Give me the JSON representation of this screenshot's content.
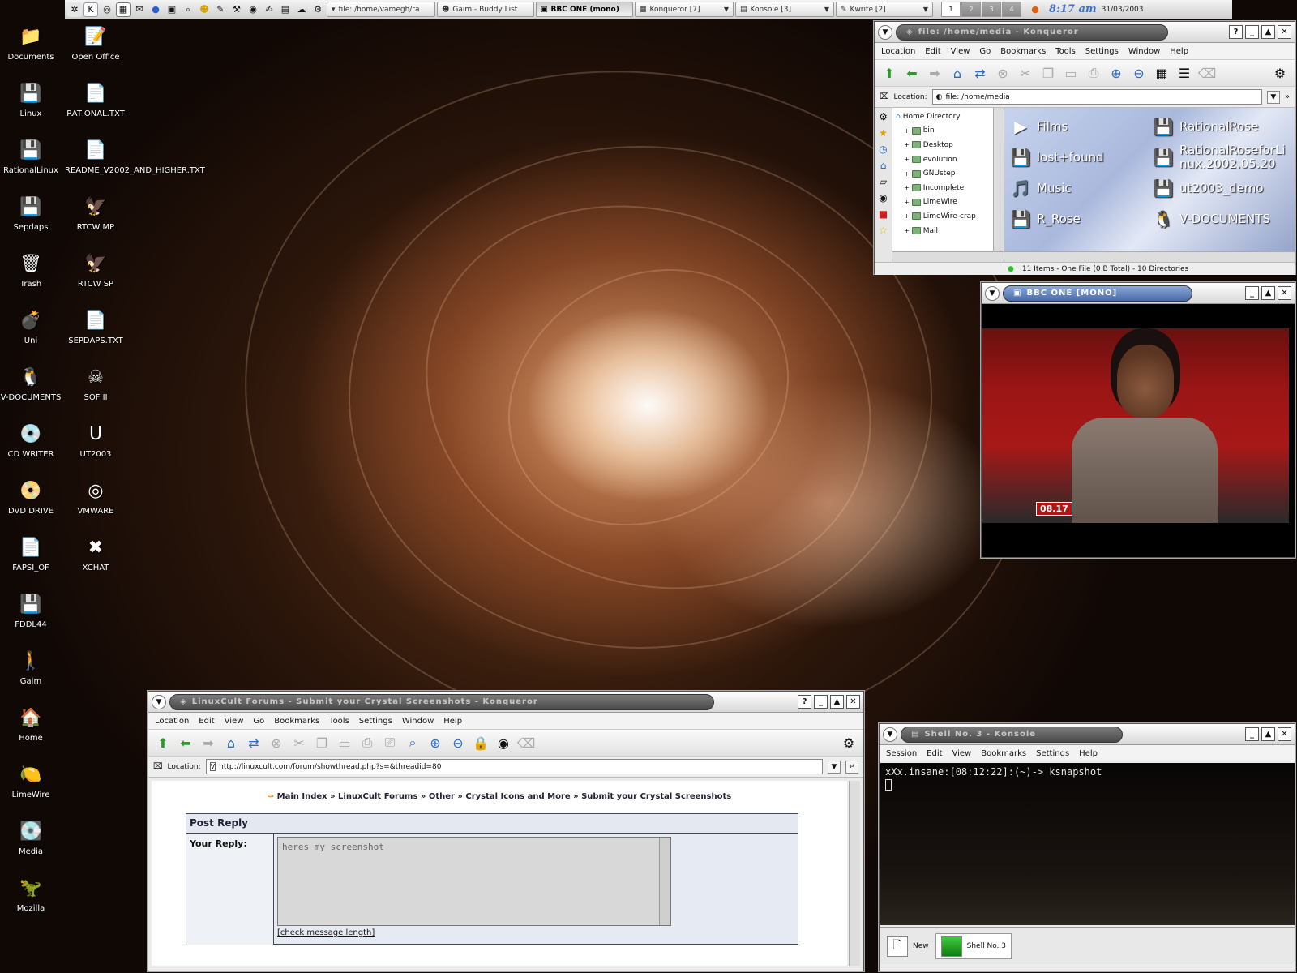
{
  "taskbar": {
    "tasks": [
      {
        "label": "file: /home/vamegh/ra",
        "active": false
      },
      {
        "label": "Gaim - Buddy List",
        "active": false
      },
      {
        "label": "BBC ONE (mono)",
        "active": true
      },
      {
        "label": "Konqueror [7]",
        "active": false
      },
      {
        "label": "Konsole [3]",
        "active": false
      },
      {
        "label": "Kwrite [2]",
        "active": false
      }
    ],
    "pager": [
      "1",
      "2",
      "3",
      "4"
    ],
    "clock": "8:17 am",
    "date": "31/03/2003"
  },
  "desktop": {
    "icons_left": [
      {
        "label": "Documents",
        "glyph": "📁"
      },
      {
        "label": "Linux",
        "glyph": "💾"
      },
      {
        "label": "RationalLinux",
        "glyph": "💾"
      },
      {
        "label": "Sepdaps",
        "glyph": "💾"
      },
      {
        "label": "Trash",
        "glyph": "🗑"
      },
      {
        "label": "Uni",
        "glyph": "💣"
      },
      {
        "label": "V-DOCUMENTS",
        "glyph": "🐧"
      },
      {
        "label": "CD WRITER",
        "glyph": "💿"
      },
      {
        "label": "DVD DRIVE",
        "glyph": "📀"
      },
      {
        "label": "FAPSI_OF",
        "glyph": "📄"
      },
      {
        "label": "FDDL44",
        "glyph": "💾"
      },
      {
        "label": "Gaim",
        "glyph": "🚶"
      },
      {
        "label": "Home",
        "glyph": "🏠"
      },
      {
        "label": "LimeWire",
        "glyph": "🍋"
      },
      {
        "label": "Media",
        "glyph": "💽"
      },
      {
        "label": "Mozilla",
        "glyph": "🦖"
      }
    ],
    "icons_right": [
      {
        "label": "Open Office",
        "glyph": "📝"
      },
      {
        "label": "RATIONAL.TXT",
        "glyph": "📄"
      },
      {
        "label": "README_V2002_AND_HIGHER.TXT",
        "glyph": "📄"
      },
      {
        "label": "RTCW MP",
        "glyph": "🦅"
      },
      {
        "label": "RTCW SP",
        "glyph": "🦅"
      },
      {
        "label": "SEPDAPS.TXT",
        "glyph": "📄"
      },
      {
        "label": "SOF II",
        "glyph": "☠"
      },
      {
        "label": "UT2003",
        "glyph": "U"
      },
      {
        "label": "VMWARE",
        "glyph": "◎"
      },
      {
        "label": "XCHAT",
        "glyph": "✖"
      }
    ]
  },
  "konq_media": {
    "title": "file: /home/media - Konqueror",
    "menu": [
      "Location",
      "Edit",
      "View",
      "Go",
      "Bookmarks",
      "Tools",
      "Settings",
      "Window",
      "Help"
    ],
    "location_label": "Location:",
    "location_value": "file: /home/media",
    "tree_root": "Home Directory",
    "tree": [
      "bin",
      "Desktop",
      "evolution",
      "GNUstep",
      "Incomplete",
      "LimeWire",
      "LimeWire-crap",
      "Mail"
    ],
    "files": [
      {
        "name": "Films",
        "glyph": "▶"
      },
      {
        "name": "RationalRose",
        "glyph": "💾"
      },
      {
        "name": "lost+found",
        "glyph": "💾"
      },
      {
        "name": "RationalRoseforLinux.2002.05.20",
        "glyph": "💾"
      },
      {
        "name": "Music",
        "glyph": "🎵"
      },
      {
        "name": "ut2003_demo",
        "glyph": "💾"
      },
      {
        "name": "R_Rose",
        "glyph": "💾"
      },
      {
        "name": "V-DOCUMENTS",
        "glyph": "🐧"
      }
    ],
    "status": "11 Items - One File (0 B Total) - 10 Directories"
  },
  "tv": {
    "title": "BBC ONE [MONO]",
    "timestamp": "08.17"
  },
  "forum": {
    "title": "LinuxCult Forums - Submit your Crystal Screenshots - Konqueror",
    "menu": [
      "Location",
      "Edit",
      "View",
      "Go",
      "Bookmarks",
      "Tools",
      "Settings",
      "Window",
      "Help"
    ],
    "location_label": "Location:",
    "url": "http://linuxcult.com/forum/showthread.php?s=&threadid=80",
    "breadcrumb": "Main Index » LinuxCult Forums » Other » Crystal Icons and More » Submit your Crystal Screenshots",
    "post_reply": "Post Reply",
    "your_reply": "Your Reply:",
    "reply_text": "heres my screenshot",
    "check_length": "[check message length]"
  },
  "konsole": {
    "title": "Shell No. 3 - Konsole",
    "menu": [
      "Session",
      "Edit",
      "View",
      "Bookmarks",
      "Settings",
      "Help"
    ],
    "prompt": "xXx.insane:[08:12:22]:(~)-> ksnapshot",
    "tab_new": "New",
    "tab_shell": "Shell No. 3"
  }
}
